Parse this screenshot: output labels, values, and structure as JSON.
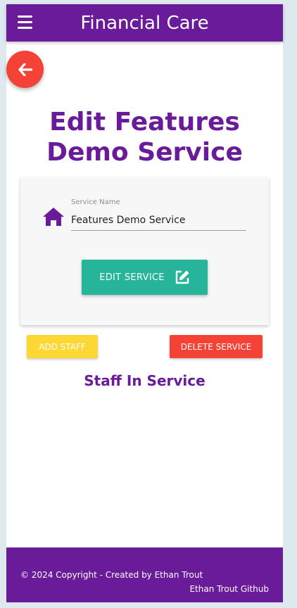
{
  "navbar": {
    "title": "Financial Care",
    "menu_icon": "hamburger-icon"
  },
  "back_button": {
    "icon": "arrow-left-icon"
  },
  "page": {
    "title": "Edit Features Demo Service"
  },
  "form": {
    "field_label": "Service Name",
    "field_value": "Features Demo Service",
    "field_icon": "home-icon",
    "edit_button_label": "EDIT SERVICE",
    "edit_button_icon": "edit-icon"
  },
  "actions": {
    "add_staff_label": "ADD STAFF",
    "delete_service_label": "DELETE SERVICE"
  },
  "staff_section": {
    "heading": "Staff In Service"
  },
  "footer": {
    "copyright": "© 2024 Copyright - Created by Ethan Trout",
    "github_link": "Ethan Trout Github"
  },
  "colors": {
    "primary": "#6a1b9a",
    "danger": "#f44336",
    "success": "#26b59a",
    "warning": "#fdd835",
    "page_bg": "#dde9ef"
  }
}
